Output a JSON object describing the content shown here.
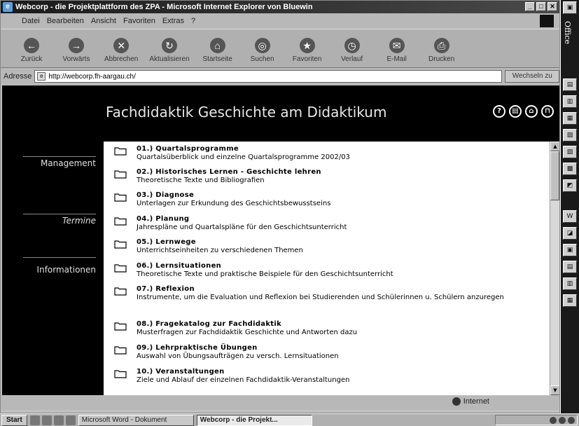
{
  "window": {
    "title": "Webcorp - die Projektplattform des ZPA - Microsoft Internet Explorer von Bluewin"
  },
  "menu": [
    "Datei",
    "Bearbeiten",
    "Ansicht",
    "Favoriten",
    "Extras",
    "?"
  ],
  "toolbar": [
    {
      "label": "Zurück",
      "icon": "back-icon"
    },
    {
      "label": "Vorwärts",
      "icon": "forward-icon"
    },
    {
      "label": "Abbrechen",
      "icon": "stop-icon"
    },
    {
      "label": "Aktualisieren",
      "icon": "refresh-icon"
    },
    {
      "label": "Startseite",
      "icon": "home-icon"
    },
    {
      "label": "Suchen",
      "icon": "search-icon"
    },
    {
      "label": "Favoriten",
      "icon": "favorites-icon"
    },
    {
      "label": "Verlauf",
      "icon": "history-icon"
    },
    {
      "label": "E-Mail",
      "icon": "mail-icon"
    },
    {
      "label": "Drucken",
      "icon": "print-icon"
    }
  ],
  "address": {
    "label": "Adresse",
    "url": "http://webcorp.fh-aargau.ch/",
    "go": "Wechseln zu"
  },
  "page": {
    "title": "Fachdidaktik Geschichte am Didaktikum",
    "header_icons": [
      "help-icon",
      "print-icon",
      "home-icon",
      "logout-icon"
    ],
    "nav": [
      {
        "label": "Management",
        "italic": false
      },
      {
        "label": "Termine",
        "italic": true
      },
      {
        "label": "Informationen",
        "italic": false
      }
    ],
    "entries": [
      {
        "title": "01.) Quartalsprogramme",
        "desc": "Quartalsüberblick und einzelne Quartalsprogramme 2002/03"
      },
      {
        "title": "02.) Historisches Lernen - Geschichte lehren",
        "desc": "Theoretische Texte und Bibliografien"
      },
      {
        "title": "03.) Diagnose",
        "desc": "Unterlagen zur Erkundung des Geschichtsbewusstseins"
      },
      {
        "title": "04.) Planung",
        "desc": "Jahrespläne und Quartalspläne für den Geschichtsunterricht"
      },
      {
        "title": "05.) Lernwege",
        "desc": "Unterrichtseinheiten zu verschiedenen Themen"
      },
      {
        "title": "06.) Lernsituationen",
        "desc": "Theoretische Texte und praktische Beispiele für den Geschichtsunterricht"
      },
      {
        "title": "07.) Reflexion",
        "desc": "Instrumente, um die Evaluation und Reflexion bei Studierenden und Schülerinnen u. Schülern anzuregen"
      },
      {
        "title": "08.) Fragekatalog zur Fachdidaktik",
        "desc": "Musterfragen zur Fachdidaktik Geschichte und Antworten dazu"
      },
      {
        "title": "09.) Lehrpraktische Übungen",
        "desc": "Auswahl von Übungsaufträgen zu versch. Lernsituationen"
      },
      {
        "title": "10.) Veranstaltungen",
        "desc": "Ziele und Ablauf der einzelnen Fachdidaktik-Veranstaltungen"
      }
    ]
  },
  "status": {
    "zone": "Internet"
  },
  "taskbar": {
    "start": "Start",
    "tasks": [
      {
        "label": "Microsoft Word - Dokument",
        "active": false
      },
      {
        "label": "Webcorp - die Projekt...",
        "active": true
      }
    ]
  },
  "office": {
    "label": "Office"
  }
}
